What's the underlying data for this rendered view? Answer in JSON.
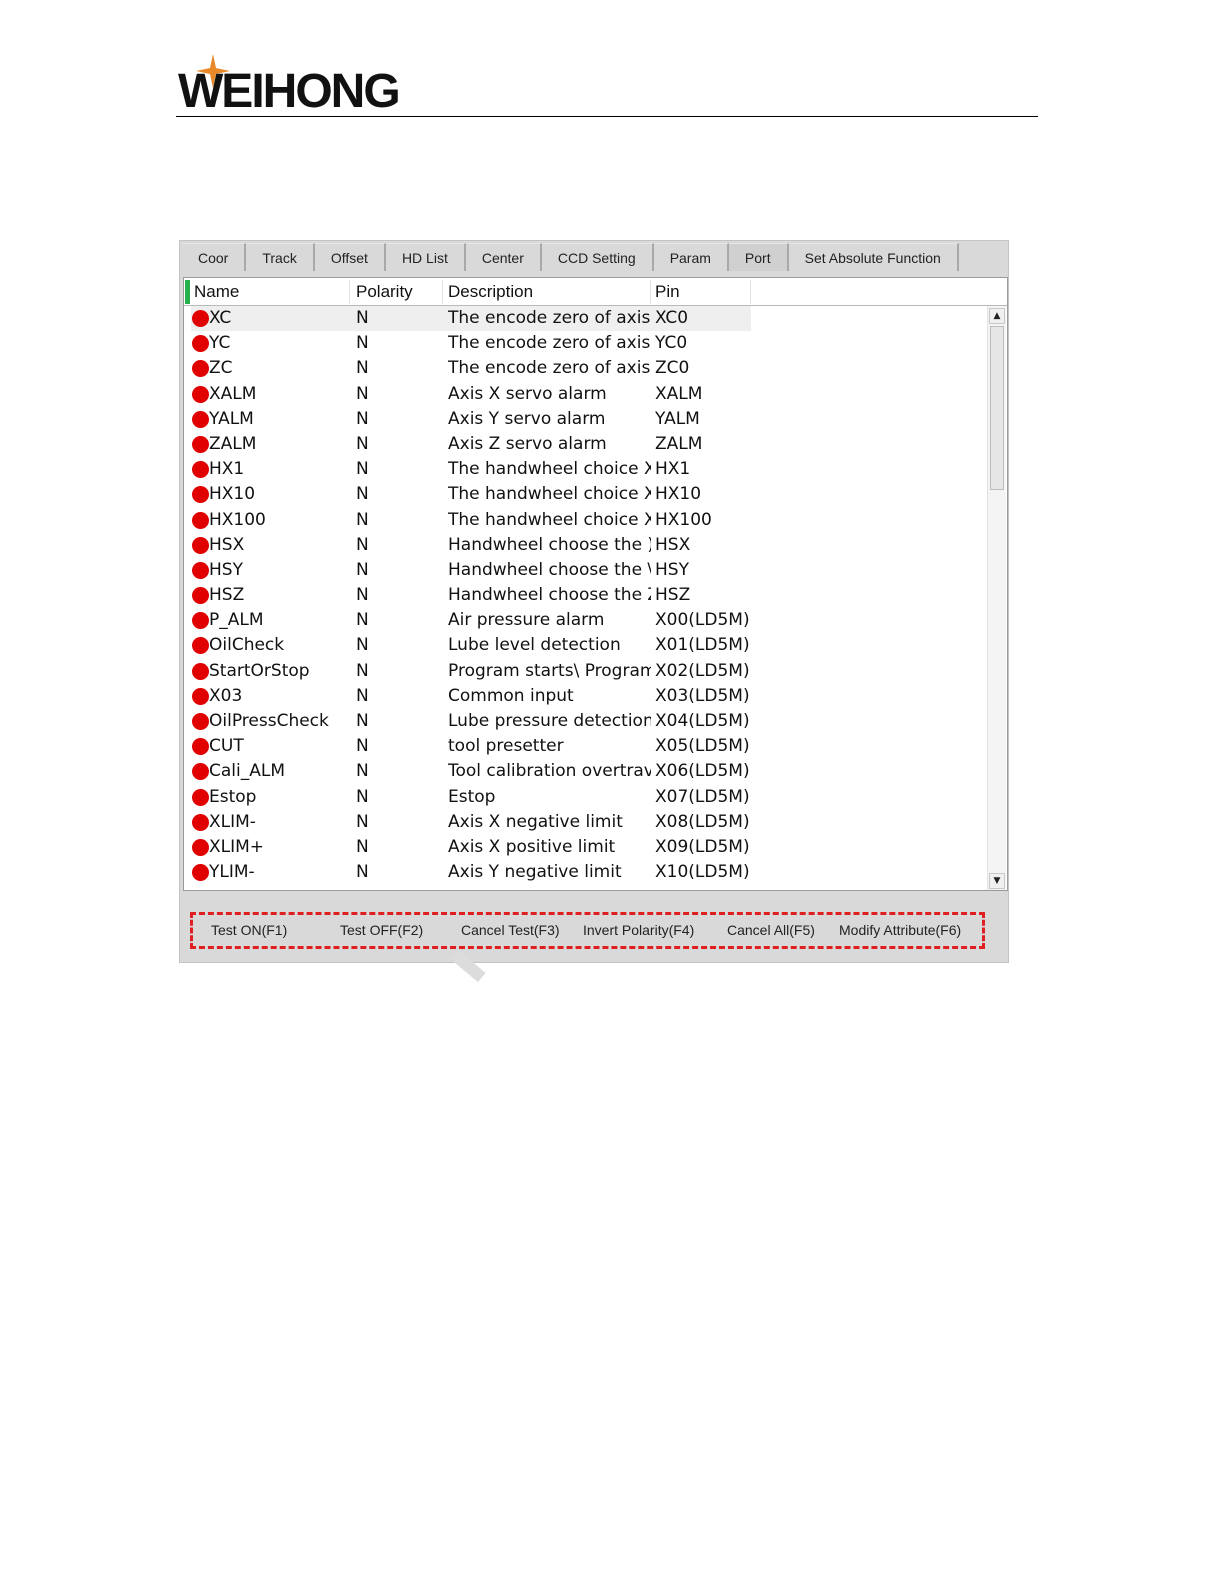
{
  "brand": {
    "logo_text": "WEIHONG"
  },
  "tabs": [
    {
      "label": "Coor"
    },
    {
      "label": "Track"
    },
    {
      "label": "Offset"
    },
    {
      "label": "HD List"
    },
    {
      "label": "Center"
    },
    {
      "label": "CCD Setting"
    },
    {
      "label": "Param"
    },
    {
      "label": "Port",
      "active": true
    },
    {
      "label": "Set Absolute Function"
    }
  ],
  "columns": {
    "name": "Name",
    "polarity": "Polarity",
    "description": "Description",
    "pin": "Pin"
  },
  "rows": [
    {
      "name": "XC",
      "polarity": "N",
      "description": "The encode zero of axis",
      "pin": "XC0"
    },
    {
      "name": "YC",
      "polarity": "N",
      "description": "The encode zero of axis",
      "pin": "YC0"
    },
    {
      "name": "ZC",
      "polarity": "N",
      "description": "The encode zero of axis",
      "pin": "ZC0"
    },
    {
      "name": "XALM",
      "polarity": "N",
      "description": "Axis X servo alarm",
      "pin": "XALM"
    },
    {
      "name": "YALM",
      "polarity": "N",
      "description": "Axis Y servo alarm",
      "pin": "YALM"
    },
    {
      "name": "ZALM",
      "polarity": "N",
      "description": "Axis Z servo alarm",
      "pin": "ZALM"
    },
    {
      "name": "HX1",
      "polarity": "N",
      "description": "The handwheel choice X",
      "pin": "HX1"
    },
    {
      "name": "HX10",
      "polarity": "N",
      "description": "The handwheel choice X",
      "pin": "HX10"
    },
    {
      "name": "HX100",
      "polarity": "N",
      "description": "The handwheel choice X",
      "pin": "HX100"
    },
    {
      "name": "HSX",
      "polarity": "N",
      "description": "Handwheel choose the )",
      "pin": "HSX"
    },
    {
      "name": "HSY",
      "polarity": "N",
      "description": "Handwheel choose the \\",
      "pin": "HSY"
    },
    {
      "name": "HSZ",
      "polarity": "N",
      "description": "Handwheel choose the Z",
      "pin": "HSZ"
    },
    {
      "name": "P_ALM",
      "polarity": "N",
      "description": "Air pressure alarm",
      "pin": "X00(LD5M)"
    },
    {
      "name": "OilCheck",
      "polarity": "N",
      "description": "Lube level detection",
      "pin": "X01(LD5M)"
    },
    {
      "name": "StartOrStop",
      "polarity": "N",
      "description": "Program starts\\ Program",
      "pin": "X02(LD5M)"
    },
    {
      "name": "X03",
      "polarity": "N",
      "description": "Common input",
      "pin": "X03(LD5M)"
    },
    {
      "name": "OilPressCheck",
      "polarity": "N",
      "description": "Lube pressure detection",
      "pin": "X04(LD5M)"
    },
    {
      "name": "CUT",
      "polarity": "N",
      "description": "tool presetter",
      "pin": "X05(LD5M)"
    },
    {
      "name": "Cali_ALM",
      "polarity": "N",
      "description": "Tool calibration overtrav",
      "pin": "X06(LD5M)"
    },
    {
      "name": "Estop",
      "polarity": "N",
      "description": "Estop",
      "pin": "X07(LD5M)"
    },
    {
      "name": "XLIM-",
      "polarity": "N",
      "description": "Axis X negative limit",
      "pin": "X08(LD5M)"
    },
    {
      "name": "XLIM+",
      "polarity": "N",
      "description": "Axis X positive limit",
      "pin": "X09(LD5M)"
    },
    {
      "name": "YLIM-",
      "polarity": "N",
      "description": "Axis Y negative limit",
      "pin": "X10(LD5M)"
    }
  ],
  "buttons": {
    "test_on": "Test ON(F1)",
    "test_off": "Test OFF(F2)",
    "cancel_test": "Cancel Test(F3)",
    "invert_polarity": "Invert Polarity(F4)",
    "cancel_all": "Cancel All(F5)",
    "modify_attribute": "Modify Attribute(F6)"
  },
  "colors": {
    "status_dot": "#e00000",
    "highlight_border": "#e02020",
    "brand_star": "#e8892a"
  },
  "icons": {
    "status": "status-dot-icon",
    "scroll_up": "arrow-up-icon",
    "scroll_down": "arrow-down-icon"
  }
}
